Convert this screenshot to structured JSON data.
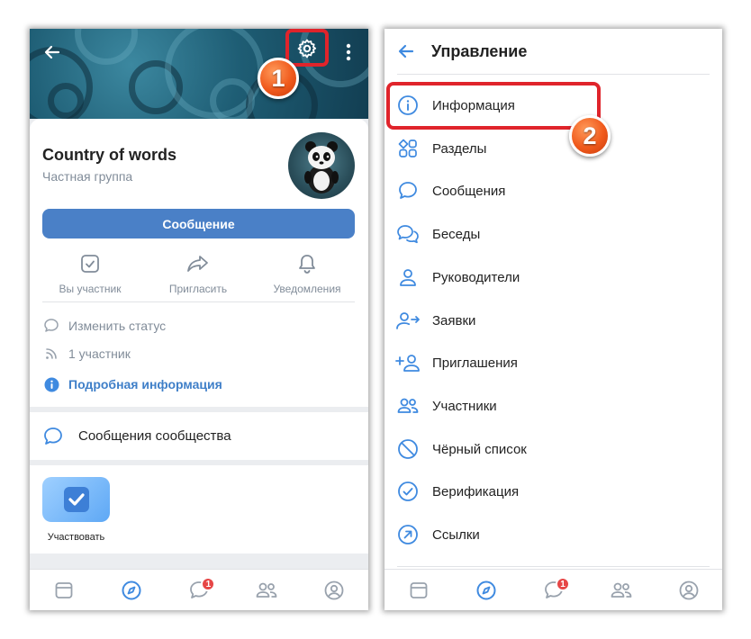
{
  "left": {
    "group_name": "Country of words",
    "group_type": "Частная группа",
    "message_button": "Сообщение",
    "actions": [
      {
        "label": "Вы участник",
        "icon": "checkbox-icon"
      },
      {
        "label": "Пригласить",
        "icon": "share-arrow-icon"
      },
      {
        "label": "Уведомления",
        "icon": "bell-icon"
      }
    ],
    "info_rows": [
      {
        "label": "Изменить статус",
        "icon": "speech-bubble-icon"
      },
      {
        "label": "1 участник",
        "icon": "rss-icon"
      },
      {
        "label": "Подробная информация",
        "icon": "info-filled-icon"
      }
    ],
    "community_messages": "Сообщения сообщества",
    "participate_label": "Участвовать",
    "callout_number": "1"
  },
  "right": {
    "title": "Управление",
    "menu": [
      {
        "label": "Информация",
        "icon": "info-icon"
      },
      {
        "label": "Разделы",
        "icon": "sections-icon"
      },
      {
        "label": "Сообщения",
        "icon": "message-icon"
      },
      {
        "label": "Беседы",
        "icon": "chats-icon"
      },
      {
        "label": "Руководители",
        "icon": "user-icon"
      },
      {
        "label": "Заявки",
        "icon": "user-requests-icon"
      },
      {
        "label": "Приглашения",
        "icon": "user-add-icon"
      },
      {
        "label": "Участники",
        "icon": "users-icon"
      },
      {
        "label": "Чёрный список",
        "icon": "block-icon"
      },
      {
        "label": "Верификация",
        "icon": "check-circle-icon"
      },
      {
        "label": "Ссылки",
        "icon": "link-icon"
      }
    ],
    "callout_number": "2"
  },
  "tabbar": {
    "items": [
      "news-icon",
      "explore-icon",
      "messages-icon",
      "friends-icon",
      "profile-icon"
    ],
    "messages_badge": "1"
  },
  "colors": {
    "accent": "#4a80c7",
    "icon_blue": "#3f8ae0",
    "highlight_red": "#e0242b",
    "callout_orange": "#f05a1c",
    "badge_red": "#e64646"
  }
}
